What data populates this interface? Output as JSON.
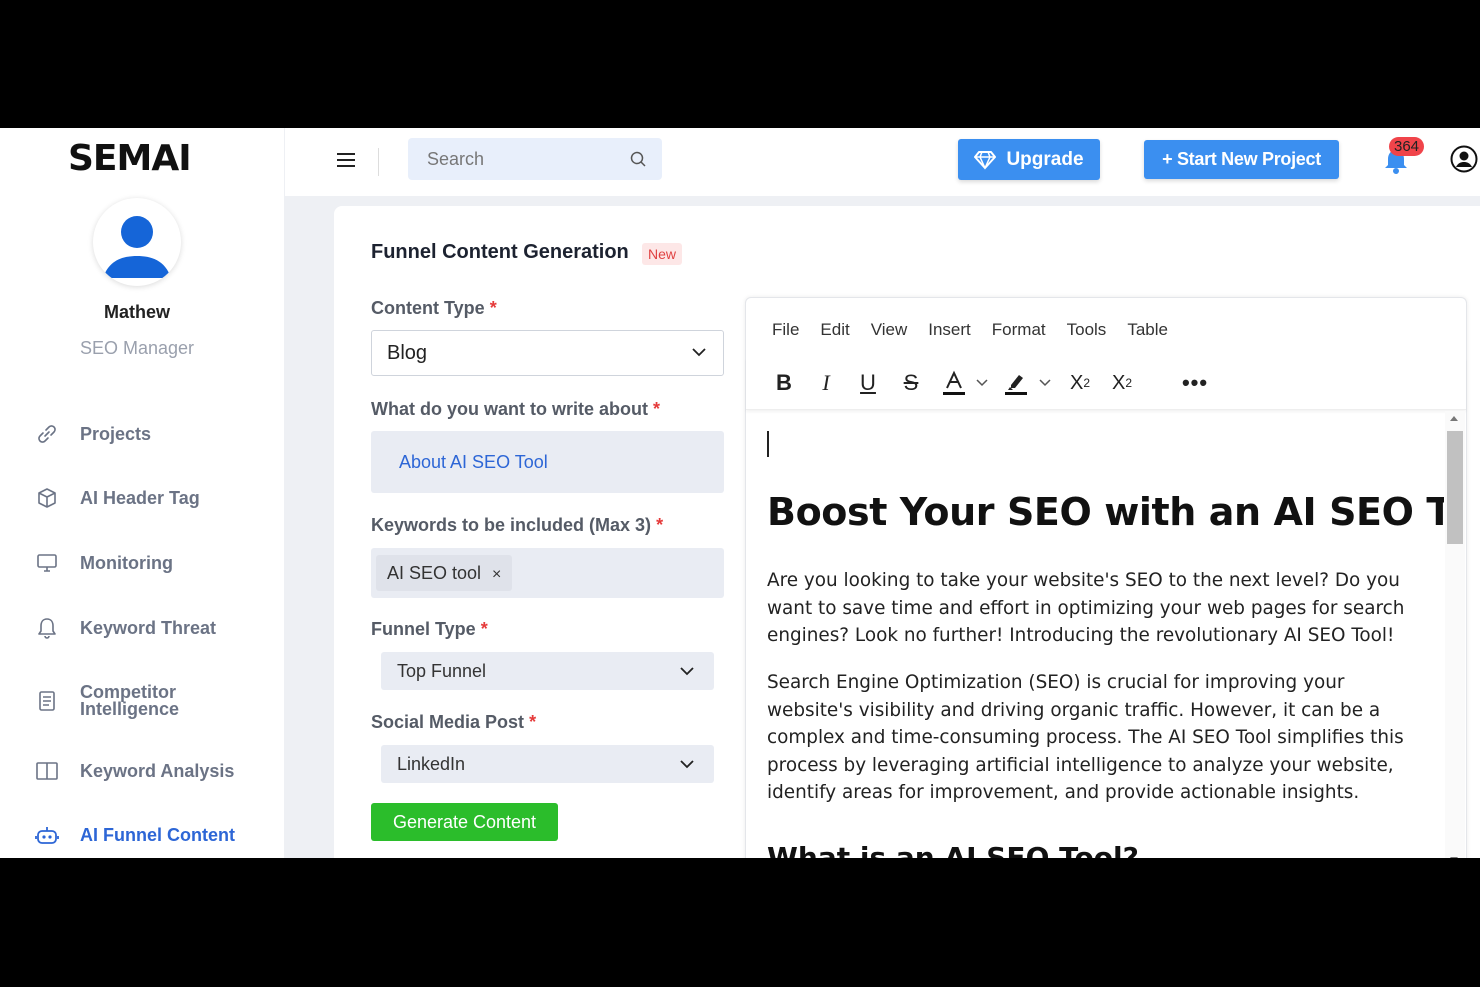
{
  "app": {
    "logo": "SEMAI",
    "search_placeholder": "Search",
    "upgrade_label": "Upgrade",
    "new_project_label": "+ Start New Project",
    "notification_count": "364"
  },
  "user": {
    "name": "Mathew",
    "role": "SEO Manager"
  },
  "sidebar": {
    "items": [
      {
        "label": "Projects",
        "icon": "link-icon"
      },
      {
        "label": "AI Header Tag",
        "icon": "cube-icon"
      },
      {
        "label": "Monitoring",
        "icon": "monitor-icon"
      },
      {
        "label": "Keyword Threat",
        "icon": "bell-icon"
      },
      {
        "label": "Competitor Intelligence",
        "icon": "document-icon"
      },
      {
        "label": "Keyword Analysis",
        "icon": "columns-icon"
      },
      {
        "label": "AI Funnel Content",
        "icon": "robot-icon",
        "active": true
      }
    ]
  },
  "form": {
    "title": "Funnel Content Generation",
    "new_badge": "New",
    "content_type_label": "Content Type",
    "content_type_value": "Blog",
    "about_label": "What do you want to write about",
    "about_value": "About AI SEO Tool",
    "keywords_label": "Keywords to be included (Max 3)",
    "keywords": [
      "AI SEO tool"
    ],
    "funnel_type_label": "Funnel Type",
    "funnel_type_value": "Top Funnel",
    "social_label": "Social Media Post",
    "social_value": "LinkedIn",
    "required_mark": "*",
    "generate_label": "Generate Content"
  },
  "editor": {
    "menu": [
      "File",
      "Edit",
      "View",
      "Insert",
      "Format",
      "Tools",
      "Table"
    ],
    "heading": "Boost Your SEO with an AI SEO Tool",
    "paragraphs": [
      "Are you looking to take your website's SEO to the next level? Do you want to save time and effort in optimizing your web pages for search engines? Look no further! Introducing the revolutionary AI SEO Tool!",
      "Search Engine Optimization (SEO) is crucial for improving your website's visibility and driving organic traffic. However, it can be a complex and time-consuming process. The AI SEO Tool simplifies this process by leveraging artificial intelligence to analyze your website, identify areas for improvement, and provide actionable insights."
    ],
    "subheading": "What is an AI SEO Tool?"
  },
  "colors": {
    "primary": "#3b8ff0",
    "active_nav": "#2d66d6",
    "success": "#2bbd2b",
    "danger": "#e53a3a"
  }
}
